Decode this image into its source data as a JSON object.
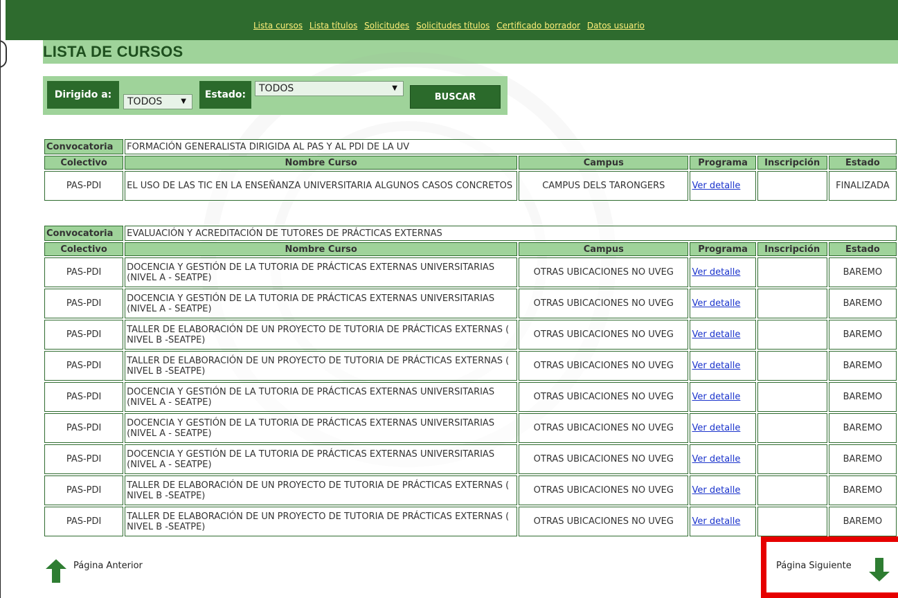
{
  "nav": {
    "links": [
      "Lista cursos",
      "Lista títulos",
      "Solicitudes",
      "Solicitudes títulos",
      "Certificado borrador",
      "Datos usuario"
    ]
  },
  "page_title": "LISTA DE CURSOS",
  "filters": {
    "dirigido_label": "Dirigido a:",
    "dirigido_value": "TODOS",
    "estado_label": "Estado:",
    "estado_value": "TODOS",
    "buscar_label": "BUSCAR"
  },
  "columns": [
    "Colectivo",
    "Nombre Curso",
    "Campus",
    "Programa",
    "Inscripción",
    "Estado"
  ],
  "convocatoria_label": "Convocatoria",
  "groups": [
    {
      "convocatoria": "FORMACIÓN GENERALISTA DIRIGIDA AL PAS Y AL PDI DE LA UV",
      "rows": [
        {
          "colectivo": "PAS-PDI",
          "nombre": "EL USO DE LAS TIC EN LA ENSEÑANZA UNIVERSITARIA ALGUNOS CASOS CONCRETOS",
          "campus": "CAMPUS DELS TARONGERS",
          "programa": "Ver detalle",
          "inscripcion": "",
          "estado": "FINALIZADA"
        }
      ]
    },
    {
      "convocatoria": "EVALUACIÓN Y ACREDITACIÓN DE TUTORES DE PRÁCTICAS EXTERNAS",
      "rows": [
        {
          "colectivo": "PAS-PDI",
          "nombre": "DOCENCIA Y GESTIÓN DE LA TUTORIA DE PRÁCTICAS EXTERNAS UNIVERSITARIAS (NIVEL A - SEATPE)",
          "campus": "OTRAS UBICACIONES NO UVEG",
          "programa": "Ver detalle",
          "inscripcion": "",
          "estado": "BAREMO"
        },
        {
          "colectivo": "PAS-PDI",
          "nombre": "DOCENCIA Y GESTIÓN DE LA TUTORIA DE PRÁCTICAS EXTERNAS UNIVERSITARIAS (NIVEL A - SEATPE)",
          "campus": "OTRAS UBICACIONES NO UVEG",
          "programa": "Ver detalle",
          "inscripcion": "",
          "estado": "BAREMO"
        },
        {
          "colectivo": "PAS-PDI",
          "nombre": "TALLER DE ELABORACIÓN DE UN PROYECTO DE TUTORIA DE PRÁCTICAS EXTERNAS ( NIVEL B -SEATPE)",
          "campus": "OTRAS UBICACIONES NO UVEG",
          "programa": "Ver detalle",
          "inscripcion": "",
          "estado": "BAREMO"
        },
        {
          "colectivo": "PAS-PDI",
          "nombre": "TALLER DE ELABORACIÓN DE UN PROYECTO DE TUTORIA DE PRÁCTICAS EXTERNAS ( NIVEL B -SEATPE)",
          "campus": "OTRAS UBICACIONES NO UVEG",
          "programa": "Ver detalle",
          "inscripcion": "",
          "estado": "BAREMO"
        },
        {
          "colectivo": "PAS-PDI",
          "nombre": "DOCENCIA Y GESTIÓN DE LA TUTORIA DE PRÁCTICAS EXTERNAS UNIVERSITARIAS (NIVEL A - SEATPE)",
          "campus": "OTRAS UBICACIONES NO UVEG",
          "programa": "Ver detalle",
          "inscripcion": "",
          "estado": "BAREMO"
        },
        {
          "colectivo": "PAS-PDI",
          "nombre": "DOCENCIA Y GESTIÓN DE LA TUTORIA DE PRÁCTICAS EXTERNAS UNIVERSITARIAS (NIVEL A - SEATPE)",
          "campus": "OTRAS UBICACIONES NO UVEG",
          "programa": "Ver detalle",
          "inscripcion": "",
          "estado": "BAREMO"
        },
        {
          "colectivo": "PAS-PDI",
          "nombre": "DOCENCIA Y GESTIÓN DE LA TUTORIA DE PRÁCTICAS EXTERNAS UNIVERSITARIAS (NIVEL A - SEATPE)",
          "campus": "OTRAS UBICACIONES NO UVEG",
          "programa": "Ver detalle",
          "inscripcion": "",
          "estado": "BAREMO"
        },
        {
          "colectivo": "PAS-PDI",
          "nombre": "TALLER DE ELABORACIÓN DE UN PROYECTO DE TUTORIA DE PRÁCTICAS EXTERNAS ( NIVEL B -SEATPE)",
          "campus": "OTRAS UBICACIONES NO UVEG",
          "programa": "Ver detalle",
          "inscripcion": "",
          "estado": "BAREMO"
        },
        {
          "colectivo": "PAS-PDI",
          "nombre": "TALLER DE ELABORACIÓN DE UN PROYECTO DE TUTORIA DE PRÁCTICAS EXTERNAS ( NIVEL B -SEATPE)",
          "campus": "OTRAS UBICACIONES NO UVEG",
          "programa": "Ver detalle",
          "inscripcion": "",
          "estado": "BAREMO"
        }
      ]
    }
  ],
  "pager": {
    "prev_label": "Página Anterior",
    "next_label": "Página Siguiente"
  },
  "icons": {
    "prev": "arrow-up-icon",
    "next": "arrow-down-icon",
    "select": "dropdown-arrow-icon"
  },
  "colors": {
    "header_green": "#2e6b2e",
    "light_green": "#9fd39a",
    "nav_link": "#ffef7a",
    "link": "#1a33cc",
    "highlight": "#e60000"
  }
}
